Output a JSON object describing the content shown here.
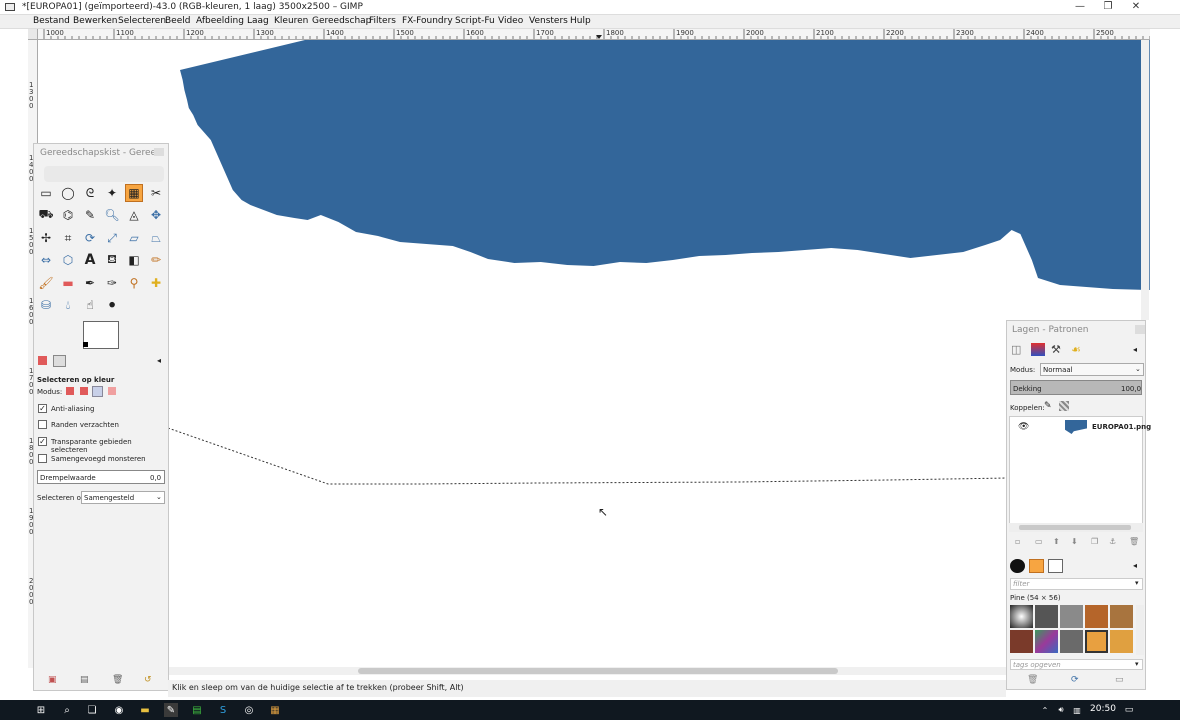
{
  "window": {
    "title": "*[EUROPA01] (geïmporteerd)-43.0 (RGB-kleuren, 1 laag) 3500x2500 – GIMP",
    "minimize": "—",
    "maximize": "❐",
    "close": "✕"
  },
  "menu": [
    "Bestand",
    "Bewerken",
    "Selecteren",
    "Beeld",
    "Afbeelding",
    "Laag",
    "Kleuren",
    "Gereedschap",
    "Filters",
    "FX-Foundry",
    "Script-Fu",
    "Video",
    "Vensters",
    "Hulp"
  ],
  "ruler": {
    "h_labels": [
      "1000",
      "1100",
      "1200",
      "1300",
      "1400",
      "1500",
      "1600",
      "1700",
      "1800",
      "1900",
      "2000",
      "2100",
      "2200",
      "2300",
      "2400",
      "2500"
    ],
    "v_labels": [
      "1300",
      "1400",
      "1500",
      "1600",
      "1700",
      "1800",
      "1900",
      "2000"
    ]
  },
  "toolbox": {
    "title": "Gereedschapskist - Geree...",
    "tool_options_title": "Selecteren op kleur",
    "mode_label": "Modus:",
    "antialias_label": "Anti-aliasing",
    "antialias_checked": true,
    "feather_label": "Randen verzachten",
    "feather_checked": false,
    "transparent_label": "Transparante gebieden selecteren",
    "transparent_checked": true,
    "merged_label": "Samengevoegd monsteren",
    "merged_checked": false,
    "threshold_label": "Drempelwaarde",
    "threshold_value": "0,0",
    "select_by_label": "Selecteren op:",
    "select_by_value": "Samengesteld",
    "fg_color": "#000000",
    "bg_color": "#ffffff"
  },
  "layers": {
    "title": "Lagen - Patronen",
    "mode_label": "Modus:",
    "mode_value": "Normaal",
    "opacity_label": "Dekking",
    "opacity_value": "100,0",
    "lock_label": "Koppelen:",
    "layer_name": "EUROPA01.png",
    "filter_placeholder": "filter",
    "pattern_name": "Pine (54 × 56)",
    "tags_placeholder": "tags opgeven"
  },
  "status": {
    "message": "Klik en sleep om van de huidige selectie af te trekken (probeer Shift, Alt)"
  },
  "taskbar": {
    "time": "20:50"
  },
  "colors": {
    "map_blue": "#33669a",
    "accent_orange": "#f7a541"
  }
}
